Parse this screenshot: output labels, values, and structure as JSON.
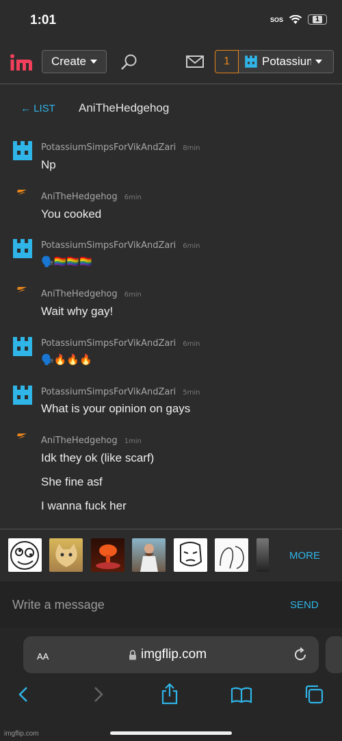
{
  "status": {
    "time": "1:01",
    "sos": "SOS",
    "battery": "1"
  },
  "nav": {
    "create_label": "Create",
    "notif_count": "1",
    "user_label": "Potassium"
  },
  "conversation": {
    "back_label": "← LIST",
    "title": "AniTheHedgehog"
  },
  "messages": [
    {
      "sender": "PotassiumSimpsForVikAndZari",
      "time": "8min",
      "lines": [
        "Np"
      ]
    },
    {
      "sender": "AniTheHedgehog",
      "time": "6min",
      "lines": [
        "You cooked"
      ]
    },
    {
      "sender": "PotassiumSimpsForVikAndZari",
      "time": "6min",
      "lines": [
        "🗣️🏳️‍🌈🏳️‍🌈🏳️‍🌈"
      ]
    },
    {
      "sender": "AniTheHedgehog",
      "time": "6min",
      "lines": [
        "Wait why gay!"
      ]
    },
    {
      "sender": "PotassiumSimpsForVikAndZari",
      "time": "6min",
      "lines": [
        "🗣️🔥🔥🔥"
      ]
    },
    {
      "sender": "PotassiumSimpsForVikAndZari",
      "time": "5min",
      "lines": [
        "What is your opinion on gays"
      ]
    },
    {
      "sender": "AniTheHedgehog",
      "time": "1min",
      "lines": [
        "Idk they ok (like scarf)",
        "She fine asf",
        "I wanna fuck her"
      ]
    }
  ],
  "emoji_bar": {
    "more_label": "MORE"
  },
  "compose": {
    "placeholder": "Write a message",
    "send_label": "SEND"
  },
  "browser": {
    "aa_label": "AA",
    "domain": "imgflip.com"
  },
  "watermark": "imgflip.com",
  "colors": {
    "accent": "#2fb5e8",
    "notif": "#e8851a",
    "bg": "#2c2c2c"
  }
}
